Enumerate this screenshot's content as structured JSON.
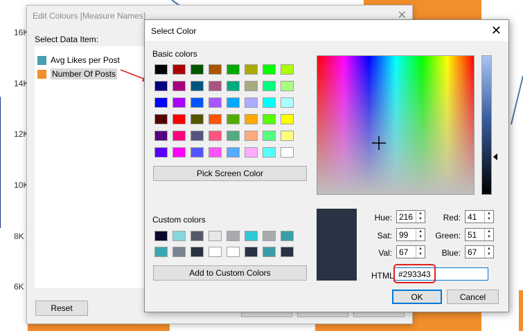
{
  "chart_data": {
    "type": "bar",
    "y_ticks": [
      "16K",
      "14K",
      "12K",
      "10K",
      "8K",
      "6K"
    ]
  },
  "edit_dialog": {
    "title": "Edit Colours [Measure Names]",
    "select_label": "Select Data Item:",
    "items": [
      {
        "label": "Avg Likes per Post",
        "color": "#4a9fb0"
      },
      {
        "label": "Number Of Posts",
        "color": "#f28e2b"
      }
    ],
    "reset_label": "Reset"
  },
  "select_color": {
    "title": "Select Color",
    "basic_colors_label": "Basic colors",
    "basic_colors": [
      [
        "#000000",
        "#aa0000",
        "#005500",
        "#aa5500",
        "#00aa00",
        "#aaaa00",
        "#00ff00",
        "#aaff00"
      ],
      [
        "#00007f",
        "#aa007f",
        "#00557f",
        "#aa557f",
        "#00aa7f",
        "#aaaa7f",
        "#00ff7f",
        "#aaff7f"
      ],
      [
        "#0000ff",
        "#aa00ff",
        "#0055ff",
        "#aa55ff",
        "#00aaff",
        "#aaaaff",
        "#00ffff",
        "#aaffff"
      ],
      [
        "#550000",
        "#ff0000",
        "#555500",
        "#ff5500",
        "#55aa00",
        "#ffaa00",
        "#55ff00",
        "#ffff00"
      ],
      [
        "#55007f",
        "#ff007f",
        "#55557f",
        "#ff557f",
        "#55aa7f",
        "#ffaa7f",
        "#55ff7f",
        "#ffff7f"
      ],
      [
        "#5500ff",
        "#ff00ff",
        "#5555ff",
        "#ff55ff",
        "#55aaff",
        "#ffaaff",
        "#55ffff",
        "#ffffff"
      ]
    ],
    "pick_screen_label": "Pick Screen Color",
    "custom_colors_label": "Custom colors",
    "custom_colors": [
      [
        "#0a0a2e",
        "#86d6e0",
        "#555a68",
        "#e8e8e8",
        "#a8aaae",
        "#2ec8d8",
        "#a8aaae",
        "#3a9ea8"
      ],
      [
        "#3aa8b2",
        "#7a8490",
        "#293343",
        "#ffffff",
        "#ffffff",
        "#293343",
        "#3a9ea8",
        "#293343"
      ]
    ],
    "add_custom_label": "Add to Custom Colors",
    "current_color": "#293343",
    "hue_label": "Hue:",
    "hue": "216",
    "sat_label": "Sat:",
    "sat": "99",
    "val_label": "Val:",
    "val": "67",
    "red_label": "Red:",
    "red": "41",
    "green_label": "Green:",
    "green": "51",
    "blue_label": "Blue:",
    "blue": "67",
    "html_label": "HTML:",
    "html_value": "#293343",
    "ok_label": "OK",
    "cancel_label": "Cancel"
  },
  "annotation": {
    "highlight_color": "#e02020"
  }
}
